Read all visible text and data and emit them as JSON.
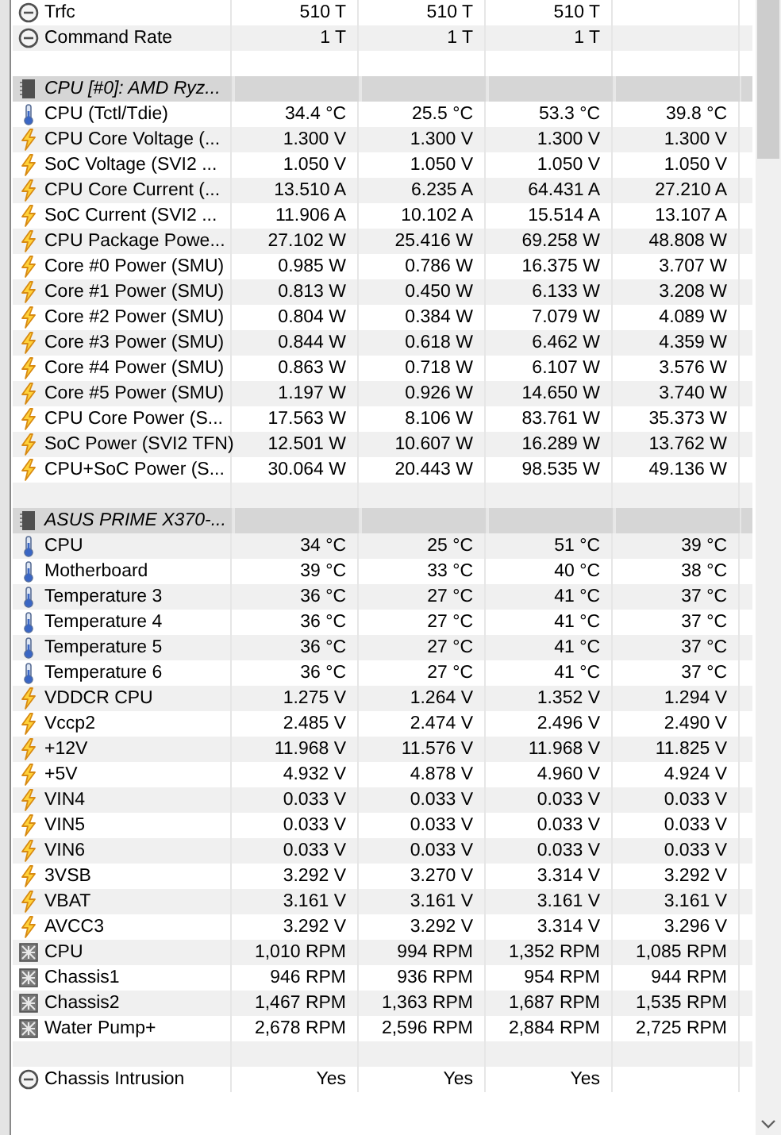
{
  "sections": [
    {
      "rows": [
        {
          "kind": "timing",
          "name": "Trfc",
          "values": [
            "510 T",
            "510 T",
            "510 T"
          ]
        },
        {
          "kind": "timing",
          "name": "Command Rate",
          "values": [
            "1 T",
            "1 T",
            "1 T"
          ]
        }
      ]
    },
    {
      "title": "CPU [#0]: AMD Ryz...",
      "rows": [
        {
          "kind": "temperature",
          "name": "CPU (Tctl/Tdie)",
          "values": [
            "34.4 °C",
            "25.5 °C",
            "53.3 °C",
            "39.8 °C"
          ]
        },
        {
          "kind": "power",
          "name": "CPU Core Voltage (...",
          "values": [
            "1.300 V",
            "1.300 V",
            "1.300 V",
            "1.300 V"
          ]
        },
        {
          "kind": "power",
          "name": "SoC Voltage (SVI2 ...",
          "values": [
            "1.050 V",
            "1.050 V",
            "1.050 V",
            "1.050 V"
          ]
        },
        {
          "kind": "power",
          "name": "CPU Core Current (...",
          "values": [
            "13.510 A",
            "6.235 A",
            "64.431 A",
            "27.210 A"
          ]
        },
        {
          "kind": "power",
          "name": "SoC Current (SVI2 ...",
          "values": [
            "11.906 A",
            "10.102 A",
            "15.514 A",
            "13.107 A"
          ]
        },
        {
          "kind": "power",
          "name": "CPU Package Powe...",
          "values": [
            "27.102 W",
            "25.416 W",
            "69.258 W",
            "48.808 W"
          ]
        },
        {
          "kind": "power",
          "name": "Core #0 Power (SMU)",
          "values": [
            "0.985 W",
            "0.786 W",
            "16.375 W",
            "3.707 W"
          ]
        },
        {
          "kind": "power",
          "name": "Core #1 Power (SMU)",
          "values": [
            "0.813 W",
            "0.450 W",
            "6.133 W",
            "3.208 W"
          ]
        },
        {
          "kind": "power",
          "name": "Core #2 Power (SMU)",
          "values": [
            "0.804 W",
            "0.384 W",
            "7.079 W",
            "4.089 W"
          ]
        },
        {
          "kind": "power",
          "name": "Core #3 Power (SMU)",
          "values": [
            "0.844 W",
            "0.618 W",
            "6.462 W",
            "4.359 W"
          ]
        },
        {
          "kind": "power",
          "name": "Core #4 Power (SMU)",
          "values": [
            "0.863 W",
            "0.718 W",
            "6.107 W",
            "3.576 W"
          ]
        },
        {
          "kind": "power",
          "name": "Core #5 Power (SMU)",
          "values": [
            "1.197 W",
            "0.926 W",
            "14.650 W",
            "3.740 W"
          ]
        },
        {
          "kind": "power",
          "name": "CPU Core Power (S...",
          "values": [
            "17.563 W",
            "8.106 W",
            "83.761 W",
            "35.373 W"
          ]
        },
        {
          "kind": "power",
          "name": "SoC Power (SVI2 TFN)",
          "values": [
            "12.501 W",
            "10.607 W",
            "16.289 W",
            "13.762 W"
          ]
        },
        {
          "kind": "power",
          "name": "CPU+SoC Power (S...",
          "values": [
            "30.064 W",
            "20.443 W",
            "98.535 W",
            "49.136 W"
          ]
        }
      ]
    },
    {
      "title": "ASUS PRIME X370-...",
      "rows": [
        {
          "kind": "temperature",
          "name": "CPU",
          "values": [
            "34 °C",
            "25 °C",
            "51 °C",
            "39 °C"
          ]
        },
        {
          "kind": "temperature",
          "name": "Motherboard",
          "values": [
            "39 °C",
            "33 °C",
            "40 °C",
            "38 °C"
          ]
        },
        {
          "kind": "temperature",
          "name": "Temperature 3",
          "values": [
            "36 °C",
            "27 °C",
            "41 °C",
            "37 °C"
          ]
        },
        {
          "kind": "temperature",
          "name": "Temperature 4",
          "values": [
            "36 °C",
            "27 °C",
            "41 °C",
            "37 °C"
          ]
        },
        {
          "kind": "temperature",
          "name": "Temperature 5",
          "values": [
            "36 °C",
            "27 °C",
            "41 °C",
            "37 °C"
          ]
        },
        {
          "kind": "temperature",
          "name": "Temperature 6",
          "values": [
            "36 °C",
            "27 °C",
            "41 °C",
            "37 °C"
          ]
        },
        {
          "kind": "power",
          "name": "VDDCR CPU",
          "values": [
            "1.275 V",
            "1.264 V",
            "1.352 V",
            "1.294 V"
          ]
        },
        {
          "kind": "power",
          "name": "Vccp2",
          "values": [
            "2.485 V",
            "2.474 V",
            "2.496 V",
            "2.490 V"
          ]
        },
        {
          "kind": "power",
          "name": "+12V",
          "values": [
            "11.968 V",
            "11.576 V",
            "11.968 V",
            "11.825 V"
          ]
        },
        {
          "kind": "power",
          "name": "+5V",
          "values": [
            "4.932 V",
            "4.878 V",
            "4.960 V",
            "4.924 V"
          ]
        },
        {
          "kind": "power",
          "name": "VIN4",
          "values": [
            "0.033 V",
            "0.033 V",
            "0.033 V",
            "0.033 V"
          ]
        },
        {
          "kind": "power",
          "name": "VIN5",
          "values": [
            "0.033 V",
            "0.033 V",
            "0.033 V",
            "0.033 V"
          ]
        },
        {
          "kind": "power",
          "name": "VIN6",
          "values": [
            "0.033 V",
            "0.033 V",
            "0.033 V",
            "0.033 V"
          ]
        },
        {
          "kind": "power",
          "name": "3VSB",
          "values": [
            "3.292 V",
            "3.270 V",
            "3.314 V",
            "3.292 V"
          ]
        },
        {
          "kind": "power",
          "name": "VBAT",
          "values": [
            "3.161 V",
            "3.161 V",
            "3.161 V",
            "3.161 V"
          ]
        },
        {
          "kind": "power",
          "name": "AVCC3",
          "values": [
            "3.292 V",
            "3.292 V",
            "3.314 V",
            "3.296 V"
          ]
        },
        {
          "kind": "fan",
          "name": "CPU",
          "values": [
            "1,010 RPM",
            "994 RPM",
            "1,352 RPM",
            "1,085 RPM"
          ]
        },
        {
          "kind": "fan",
          "name": "Chassis1",
          "values": [
            "946 RPM",
            "936 RPM",
            "954 RPM",
            "944 RPM"
          ]
        },
        {
          "kind": "fan",
          "name": "Chassis2",
          "values": [
            "1,467 RPM",
            "1,363 RPM",
            "1,687 RPM",
            "1,535 RPM"
          ]
        },
        {
          "kind": "fan",
          "name": "Water Pump+",
          "values": [
            "2,678 RPM",
            "2,596 RPM",
            "2,884 RPM",
            "2,725 RPM"
          ]
        }
      ]
    },
    {
      "rows": [
        {
          "kind": "timing",
          "name": "Chassis Intrusion",
          "values": [
            "Yes",
            "Yes",
            "Yes"
          ]
        }
      ]
    }
  ]
}
